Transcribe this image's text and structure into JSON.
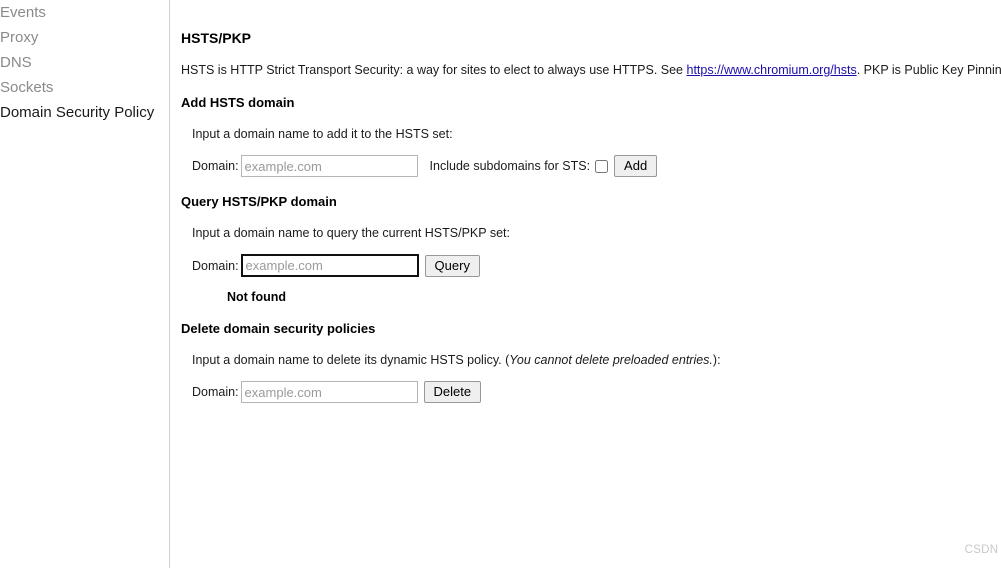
{
  "sidebar": {
    "items": [
      {
        "label": "Events",
        "selected": false
      },
      {
        "label": "Proxy",
        "selected": false
      },
      {
        "label": "DNS",
        "selected": false
      },
      {
        "label": "Sockets",
        "selected": false
      },
      {
        "label": "Domain Security Policy",
        "selected": true
      }
    ]
  },
  "main": {
    "title": "HSTS/PKP",
    "description": {
      "before_link": "HSTS is HTTP Strict Transport Security: a way for sites to elect to always use HTTPS. See ",
      "link_text": "https://www.chromium.org/hsts",
      "after_link": ". PKP is Public Key Pinning: Chrome"
    },
    "add_section": {
      "heading": "Add HSTS domain",
      "hint": "Input a domain name to add it to the HSTS set:",
      "domain_label": "Domain:",
      "domain_value": "",
      "domain_placeholder": "example.com",
      "subdomains_label": "Include subdomains for STS:",
      "subdomains_checked": false,
      "submit_label": "Add"
    },
    "query_section": {
      "heading": "Query HSTS/PKP domain",
      "hint": "Input a domain name to query the current HSTS/PKP set:",
      "domain_label": "Domain:",
      "domain_value": "",
      "domain_placeholder": "example.com",
      "submit_label": "Query",
      "result": "Not found"
    },
    "delete_section": {
      "heading": "Delete domain security policies",
      "hint_before_italic": "Input a domain name to delete its dynamic HSTS policy. (",
      "hint_italic": "You cannot delete preloaded entries.",
      "hint_after_italic": "):",
      "domain_label": "Domain:",
      "domain_value": "",
      "domain_placeholder": "example.com",
      "submit_label": "Delete"
    }
  },
  "watermark": "CSDN @ybbos"
}
